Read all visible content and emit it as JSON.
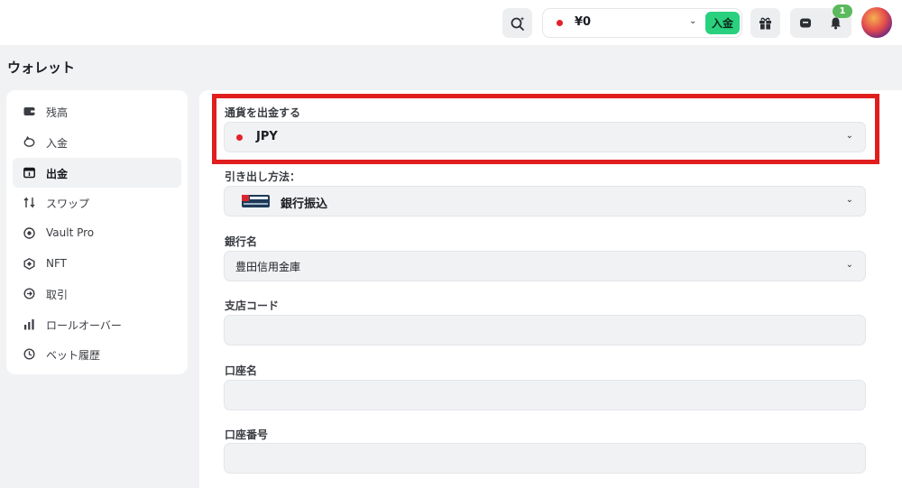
{
  "topbar": {
    "balance": "¥0",
    "deposit_label": "入金",
    "notification_count": "1"
  },
  "page": {
    "title": "ウォレット"
  },
  "sidebar": {
    "items": [
      {
        "label": "残高",
        "icon": "wallet-icon"
      },
      {
        "label": "入金",
        "icon": "piggy-bank-icon"
      },
      {
        "label": "出金",
        "icon": "withdraw-icon",
        "active": true
      },
      {
        "label": "スワップ",
        "icon": "swap-icon"
      },
      {
        "label": "Vault Pro",
        "icon": "vault-icon"
      },
      {
        "label": "NFT",
        "icon": "nft-icon"
      },
      {
        "label": "取引",
        "icon": "transaction-icon"
      },
      {
        "label": "ロールオーバー",
        "icon": "bar-chart-icon"
      },
      {
        "label": "ベット履歴",
        "icon": "clock-icon"
      }
    ]
  },
  "form": {
    "currency_label": "通貨を出金する",
    "currency_value": "JPY",
    "method_label": "引き出し方法：",
    "method_value": "銀行振込",
    "bank_name_label": "銀行名",
    "bank_name_value": "豊田信用金庫",
    "branch_code_label": "支店コード",
    "branch_code_value": "",
    "account_name_label": "口座名",
    "account_name_value": "",
    "account_number_label": "口座番号",
    "account_number_value": ""
  },
  "colors": {
    "accent_green": "#29d07e",
    "highlight_red": "#e01e1e",
    "flag_red": "#e3212b"
  }
}
